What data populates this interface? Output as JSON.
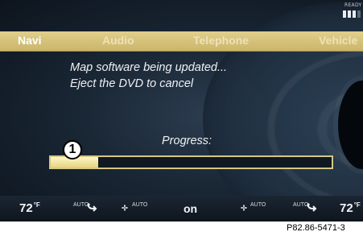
{
  "status": {
    "ready_label": "READY",
    "signal_bars_total": 4,
    "signal_bars_active": 3
  },
  "menu": {
    "items": [
      "Navi",
      "Audio",
      "Telephone",
      "Vehicle"
    ],
    "active": "Navi"
  },
  "message": {
    "line1": "Map software being updated...",
    "line2": "Eject the DVD to cancel"
  },
  "progress": {
    "label": "Progress:",
    "fraction": 0.17
  },
  "callout": "1",
  "climate": {
    "temp_left": "72",
    "temp_right": "72",
    "temp_unit": "°F",
    "airflow_left_label": "AUTO",
    "fan_left_label": "AUTO",
    "ac_status": "on",
    "fan_right_label": "AUTO",
    "airflow_right_label": "AUTO",
    "icons": [
      "airflow-icon",
      "fan-icon",
      "fan-icon",
      "airflow-icon"
    ]
  },
  "figure_code": "P82.86-5471-3",
  "colors": {
    "menu_bar": "#d6c27a",
    "progress_fill": "#f2e6a8",
    "screen_background": "#192634"
  }
}
